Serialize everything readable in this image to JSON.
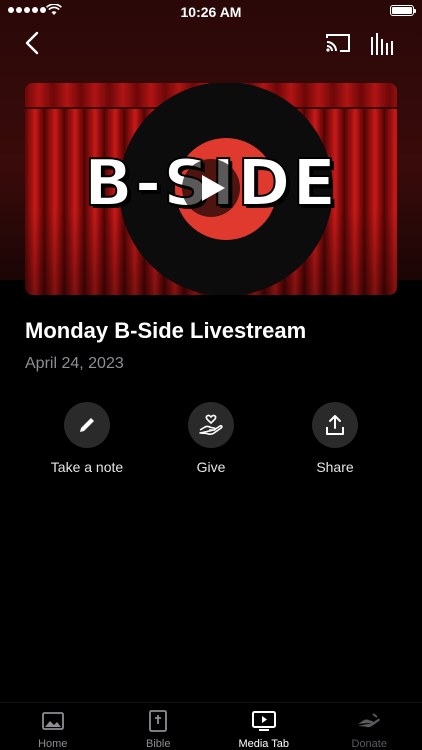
{
  "status_bar": {
    "time": "10:26 AM"
  },
  "hero": {
    "artwork_text": "B-SIDE"
  },
  "content": {
    "title": "Monday B-Side Livestream",
    "date": "April 24, 2023"
  },
  "actions": [
    {
      "label": "Take a note",
      "icon": "pencil-icon"
    },
    {
      "label": "Give",
      "icon": "heart-hand-icon"
    },
    {
      "label": "Share",
      "icon": "share-icon"
    }
  ],
  "tabbar": {
    "tabs": [
      {
        "label": "Home",
        "icon": "image-icon",
        "state": "inactive"
      },
      {
        "label": "Bible",
        "icon": "bible-icon",
        "state": "inactive"
      },
      {
        "label": "Media Tab",
        "icon": "tv-play-icon",
        "state": "active"
      },
      {
        "label": "Donate",
        "icon": "donate-icon",
        "state": "dim"
      }
    ]
  },
  "colors": {
    "background": "#000000",
    "accent_red": "#e03a2f",
    "secondary_text": "#8e8e93"
  }
}
